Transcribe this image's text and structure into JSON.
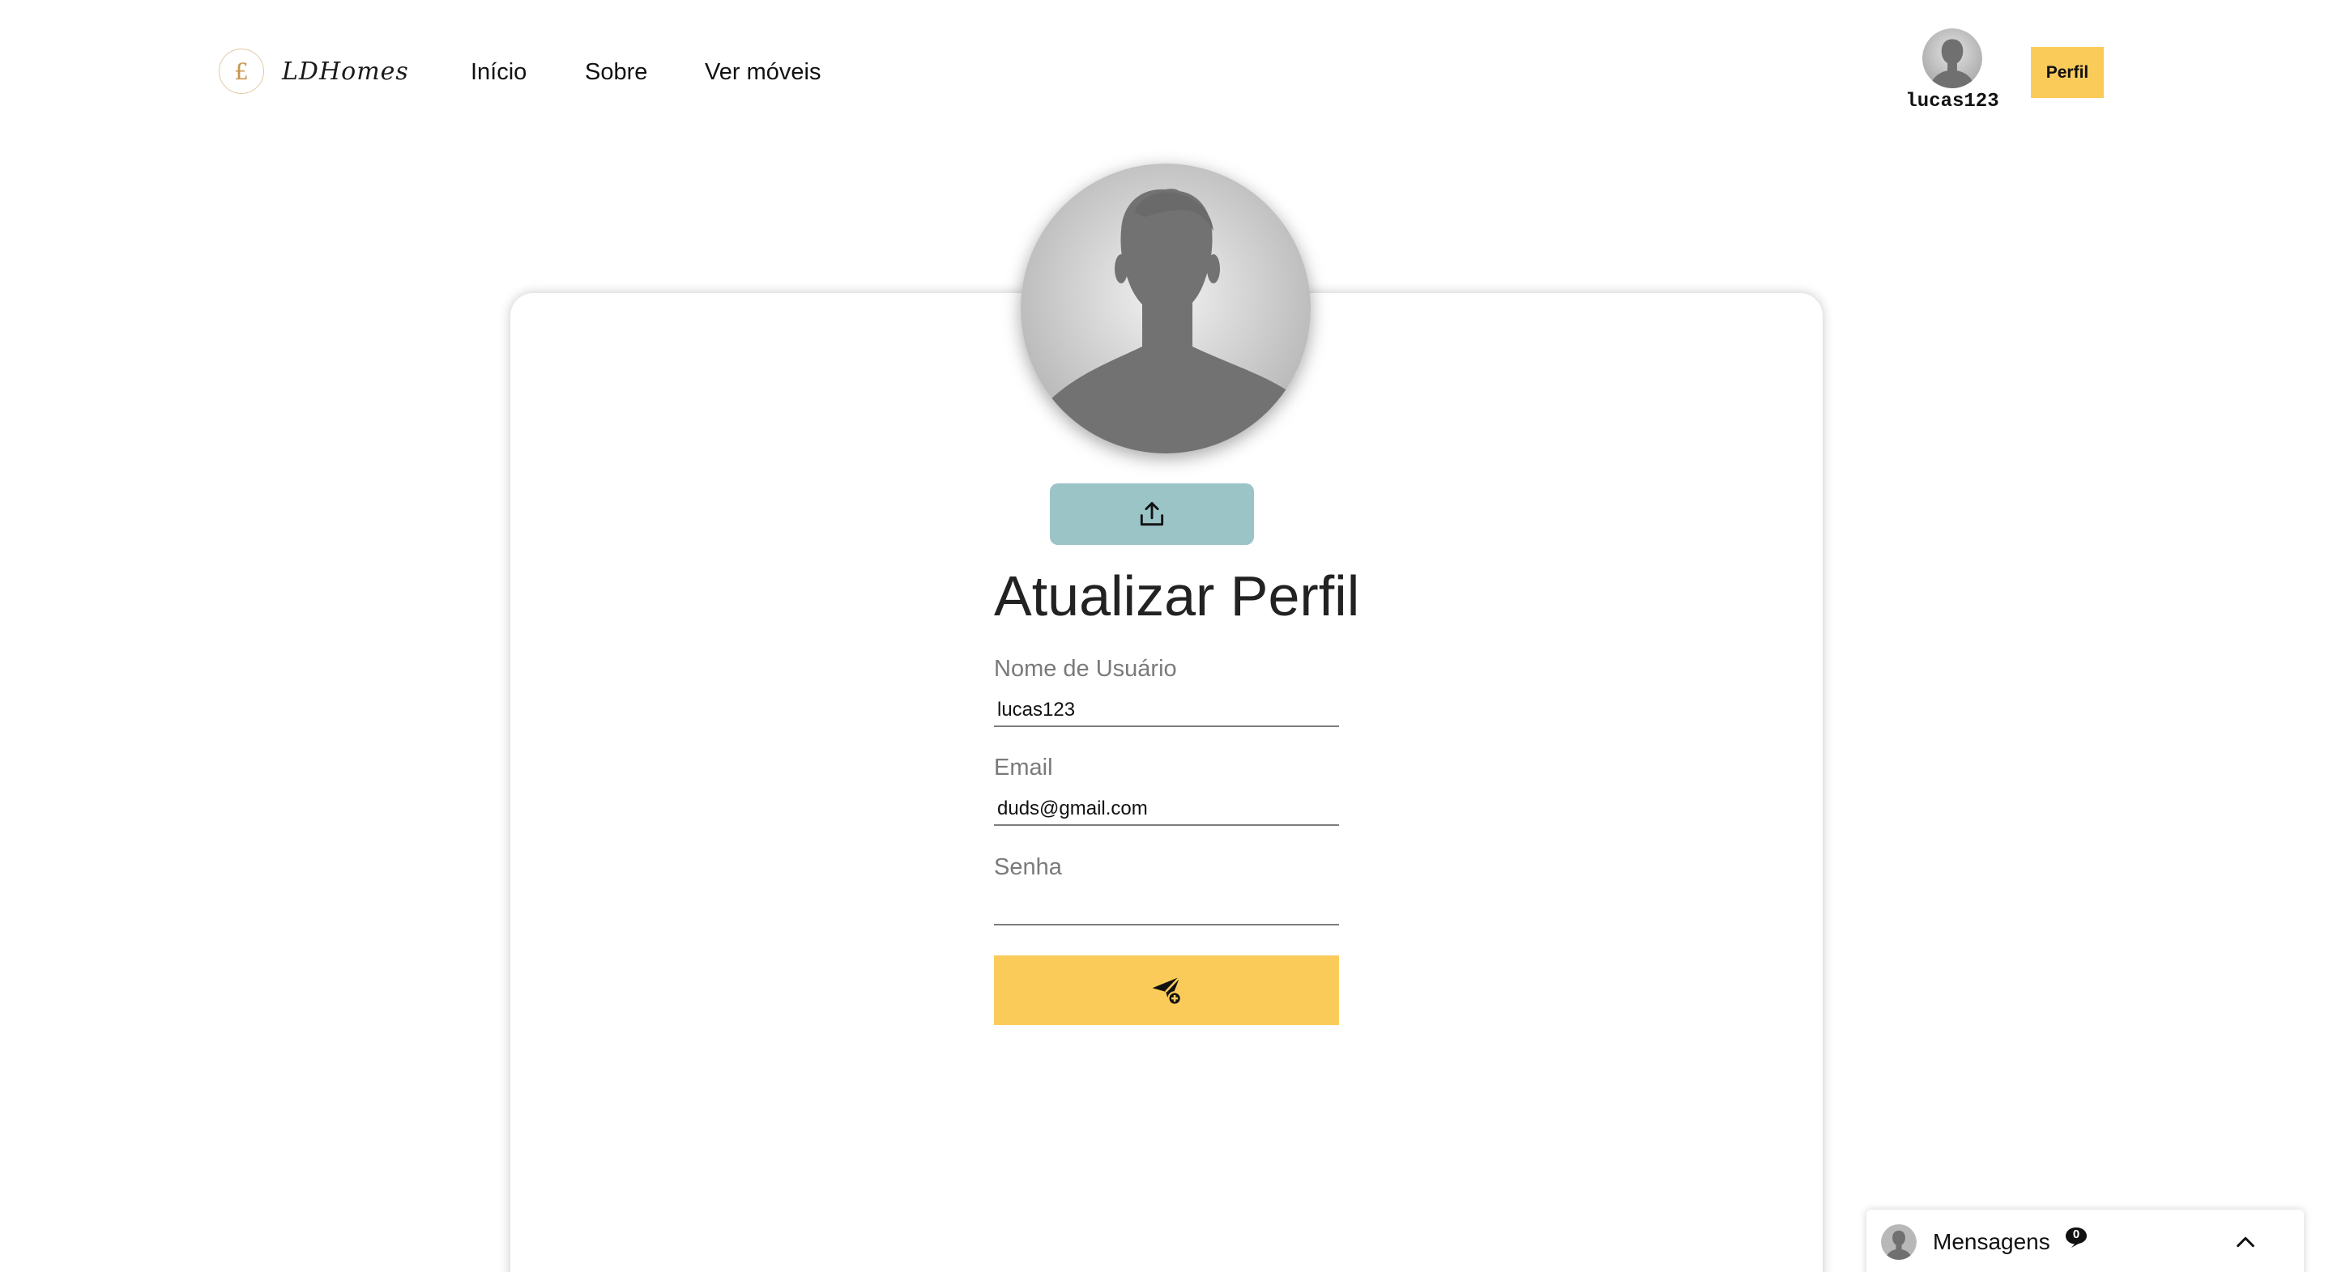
{
  "header": {
    "logo_letter": "£",
    "brand": "LDHomes",
    "nav": [
      {
        "label": "Início"
      },
      {
        "label": "Sobre"
      },
      {
        "label": "Ver móveis"
      }
    ],
    "username": "lucas123",
    "profile_button": "Perfil"
  },
  "form": {
    "title": "Atualizar Perfil",
    "fields": {
      "username": {
        "label": "Nome de Usuário",
        "value": "lucas123"
      },
      "email": {
        "label": "Email",
        "value": "duds@gmail.com"
      },
      "password": {
        "label": "Senha",
        "value": ""
      }
    },
    "upload_icon": "upload-icon",
    "submit_icon": "send-plane-icon"
  },
  "messages": {
    "title": "Mensagens",
    "count": "0",
    "toggle_icon": "chevron-up-icon"
  },
  "colors": {
    "accent_yellow": "#fbcb5a",
    "upload_teal": "#9bc4c7"
  }
}
